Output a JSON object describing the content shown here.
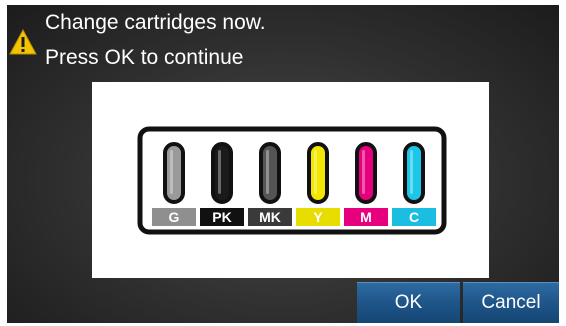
{
  "dialog": {
    "message_line1": "Change cartridges now.",
    "message_line2": "Press OK to continue",
    "warning_icon": "warning-triangle-icon",
    "warning_color": "#f5c400"
  },
  "cartridges": [
    {
      "label": "G",
      "color": "#9a9a9a",
      "label_bg": "#8f8f8f"
    },
    {
      "label": "PK",
      "color": "#1a1a1a",
      "label_bg": "#111111"
    },
    {
      "label": "MK",
      "color": "#555555",
      "label_bg": "#3a3a3a"
    },
    {
      "label": "Y",
      "color": "#f3e600",
      "label_bg": "#e8dd00"
    },
    {
      "label": "M",
      "color": "#e6007e",
      "label_bg": "#e6007e"
    },
    {
      "label": "C",
      "color": "#1bc6e8",
      "label_bg": "#1bbde0"
    }
  ],
  "buttons": {
    "ok_label": "OK",
    "cancel_label": "Cancel"
  }
}
